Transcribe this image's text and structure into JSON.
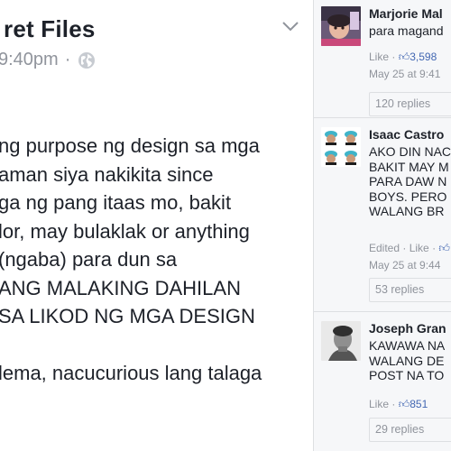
{
  "post": {
    "page_name": "ret Files",
    "timestamp": "9:40pm",
    "separator": "·",
    "chevron_icon": "chevron-down-icon",
    "privacy_icon": "globe-icon",
    "body_lines": [
      "ng purpose ng design sa mga",
      "aman siya nakikita since",
      "ga ng pang itaas mo, bakit",
      "lor, may bulaklak or anything",
      " (ngaba) para dun sa",
      "ANG MALAKING DAHILAN",
      "SA LIKOD NG MGA DESIGN",
      "",
      "lema, nacucurious lang talaga"
    ]
  },
  "comments": [
    {
      "name": "Marjorie Mal",
      "text": [
        "para magand"
      ],
      "edited": "",
      "like_label": "Like",
      "separator": "·",
      "like_count": "3,598",
      "time": "May 25 at 9:41",
      "replies": "120 replies",
      "avatar": "child-photo"
    },
    {
      "name": "Isaac Castro",
      "text": [
        "AKO DIN NAC",
        "BAKIT MAY M",
        "PARA DAW N",
        "BOYS. PERO",
        "WALANG BR"
      ],
      "edited": "Edited",
      "like_label": "Like",
      "separator": "·",
      "like_count": "",
      "time": "May 25 at 9:44",
      "replies": "53 replies",
      "avatar": "grid-of-faces"
    },
    {
      "name": "Joseph Gran",
      "text": [
        "KAWAWA NA",
        "WALANG DE",
        "POST NA TO"
      ],
      "edited": "",
      "like_label": "Like",
      "separator": "·",
      "like_count": "851",
      "time": "",
      "replies": "29 replies",
      "avatar": "portrait-photo"
    }
  ],
  "colors": {
    "link_blue": "#4267b2",
    "meta_gray": "#90949c",
    "panel_bg": "#f6f7f9",
    "divider": "#dddfe2"
  }
}
